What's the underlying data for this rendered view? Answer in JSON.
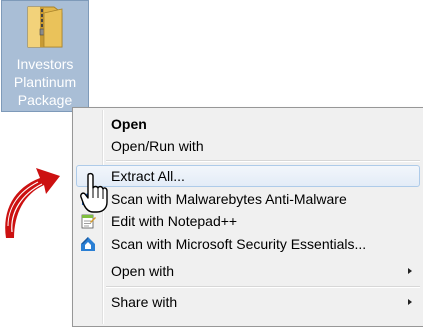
{
  "desktop_icon": {
    "label_lines": [
      "Investors",
      "Plantinum",
      "Package"
    ],
    "icon": "zip-folder-icon"
  },
  "decoration": {
    "icon": "red-curved-arrow-icon"
  },
  "context_menu": {
    "items": [
      {
        "label": "Open",
        "bold": true,
        "icon": null,
        "submenu": false
      },
      {
        "label": "Open/Run with",
        "bold": false,
        "icon": null,
        "submenu": false
      },
      {
        "label": "Extract All...",
        "bold": false,
        "icon": null,
        "submenu": false,
        "highlighted": true
      },
      {
        "label": "Scan with Malwarebytes Anti-Malware",
        "bold": false,
        "icon": "malwarebytes-icon",
        "submenu": false
      },
      {
        "label": "Edit with Notepad++",
        "bold": false,
        "icon": "notepad-plus-plus-icon",
        "submenu": false
      },
      {
        "label": "Scan with Microsoft Security Essentials...",
        "bold": false,
        "icon": "security-essentials-icon",
        "submenu": false
      },
      {
        "label": "Open with",
        "bold": false,
        "icon": null,
        "submenu": true
      },
      {
        "label": "Share with",
        "bold": false,
        "icon": null,
        "submenu": true
      }
    ]
  },
  "cursor": {
    "icon": "hand-pointer-cursor-icon"
  },
  "colors": {
    "selection_bg": "#a9bed6",
    "menu_bg": "#f0f0f0",
    "hover_border": "#aecbe9",
    "arrow_red": "#cc1111"
  }
}
